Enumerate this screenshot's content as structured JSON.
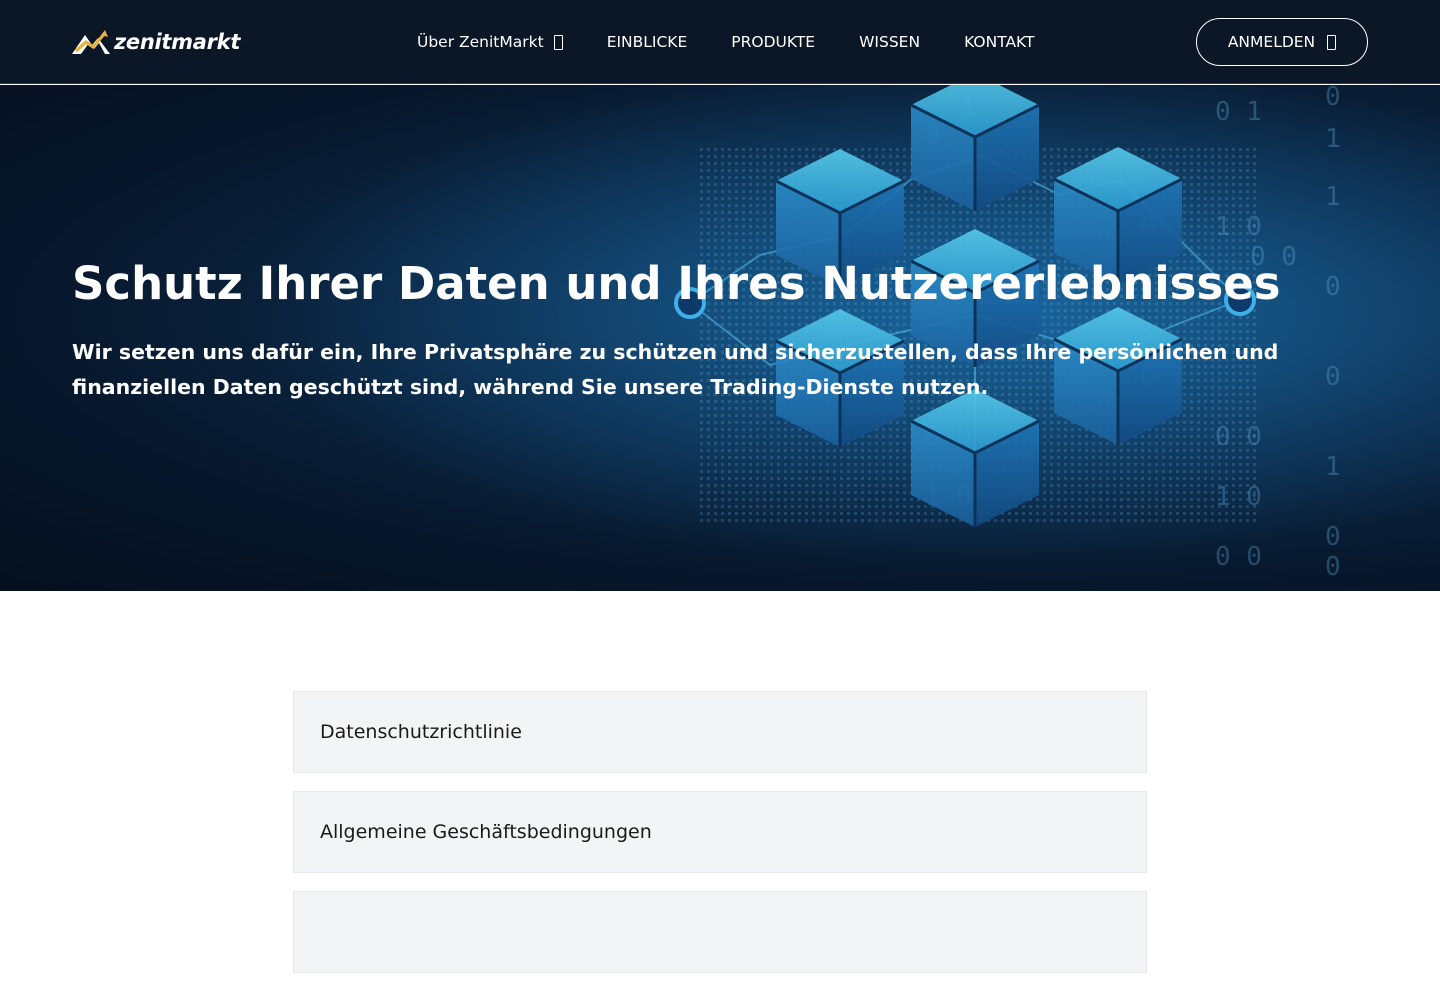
{
  "header": {
    "logo_text": "zenitmarkt",
    "nav": [
      {
        "label": "Über ZenitMarkt",
        "has_dropdown": true
      },
      {
        "label": "EINBLICKE"
      },
      {
        "label": "PRODUKTE"
      },
      {
        "label": "WISSEN"
      },
      {
        "label": "KONTAKT"
      }
    ],
    "login_label": "ANMELDEN"
  },
  "hero": {
    "title": "Schutz Ihrer Daten und Ihres Nutzererlebnisses",
    "subtitle": "Wir setzen uns dafür ein, Ihre Privatsphäre zu schützen und sicherzustellen, dass Ihre persönlichen und finanziellen Daten geschützt sind, während Sie unsere Trading-Dienste nutzen."
  },
  "accordion": {
    "items": [
      {
        "label": "Datenschutzrichtlinie"
      },
      {
        "label": "Allgemeine Geschäftsbedingungen"
      },
      {
        "label": ""
      }
    ]
  },
  "colors": {
    "header_bg": "#0b1626",
    "hero_accent": "#2fa8e6",
    "accordion_bg": "#f3f4f6"
  },
  "icons": {
    "logo": "mountain-chart-icon",
    "dropdown": "chevron-down-icon",
    "login": "login-arrow-icon"
  }
}
